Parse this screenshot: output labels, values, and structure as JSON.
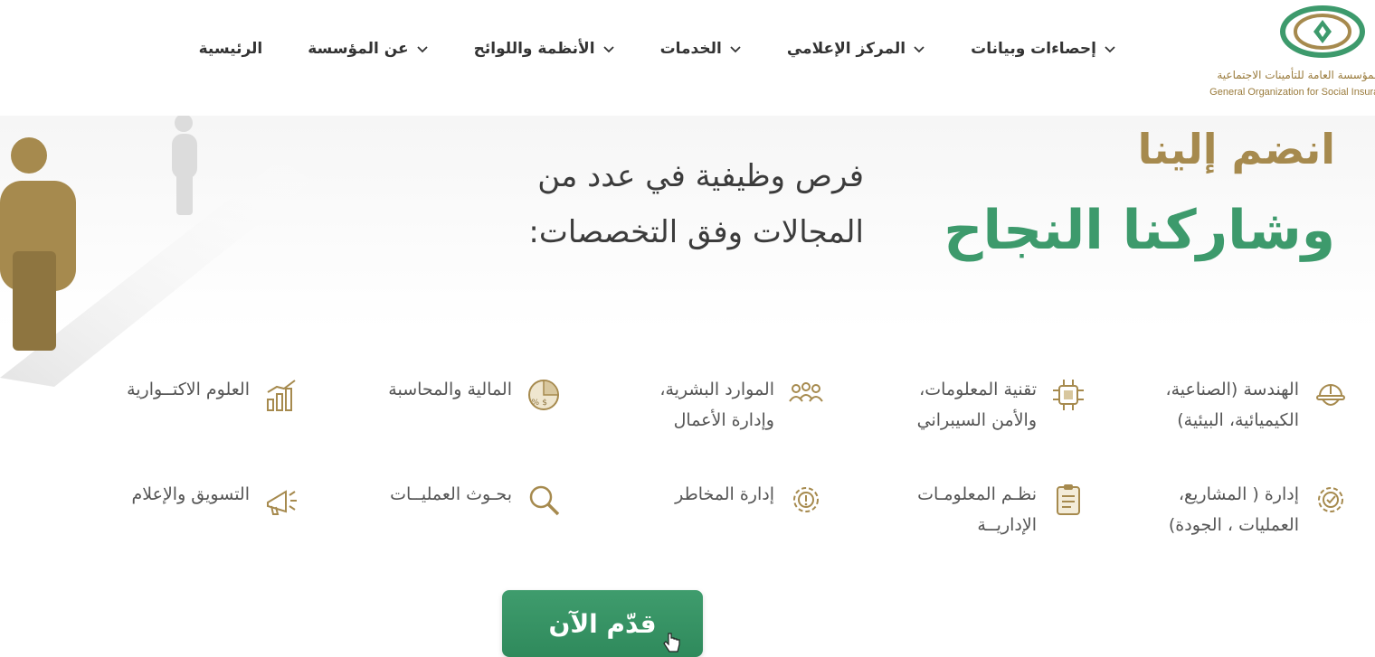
{
  "header": {
    "logo_ar": "المؤسسة العامة للتأمينات الاجتماعية",
    "logo_en": "General Organization for Social Insurance",
    "nav": [
      {
        "label": "الرئيسية",
        "dropdown": false
      },
      {
        "label": "عن المؤسسة",
        "dropdown": true
      },
      {
        "label": "الأنظمة واللوائح",
        "dropdown": true
      },
      {
        "label": "الخدمات",
        "dropdown": true
      },
      {
        "label": "المركز الإعلامي",
        "dropdown": true
      },
      {
        "label": "إحصاءات وبيانات",
        "dropdown": true
      }
    ]
  },
  "hero": {
    "join_title": "انضم إلينا",
    "success_title": "وشاركنا النجاح",
    "intro_line1": "فرص وظيفية في عدد من",
    "intro_line2": "المجالات وفق التخصصات:"
  },
  "fields": [
    {
      "label": "الهندسة (الصناعية،\nالكيميائية، البيئية)",
      "icon": "engineer-helmet-icon"
    },
    {
      "label": "تقنية المعلومات،\nوالأمن السيبراني",
      "icon": "chip-icon"
    },
    {
      "label": "الموارد البشرية،\nوإدارة الأعمال",
      "icon": "people-group-icon"
    },
    {
      "label": "المالية والمحاسبة",
      "icon": "finance-chart-icon"
    },
    {
      "label": "العلوم الاكتــوارية",
      "icon": "growth-chart-icon"
    },
    {
      "label": "إدارة ( المشاريع،\nالعمليات ، الجودة)",
      "icon": "gear-check-icon"
    },
    {
      "label": "نظـم المعلومـات\nالإداريــة",
      "icon": "clipboard-icon"
    },
    {
      "label": "إدارة المخاطر",
      "icon": "gear-alert-icon"
    },
    {
      "label": "بحـوث العمليــات",
      "icon": "magnifier-icon"
    },
    {
      "label": "التسويق والإعلام",
      "icon": "megaphone-icon"
    }
  ],
  "apply_label": "قدّم الآن",
  "colors": {
    "gold": "#a68a4e",
    "green": "#3d9a6c"
  }
}
